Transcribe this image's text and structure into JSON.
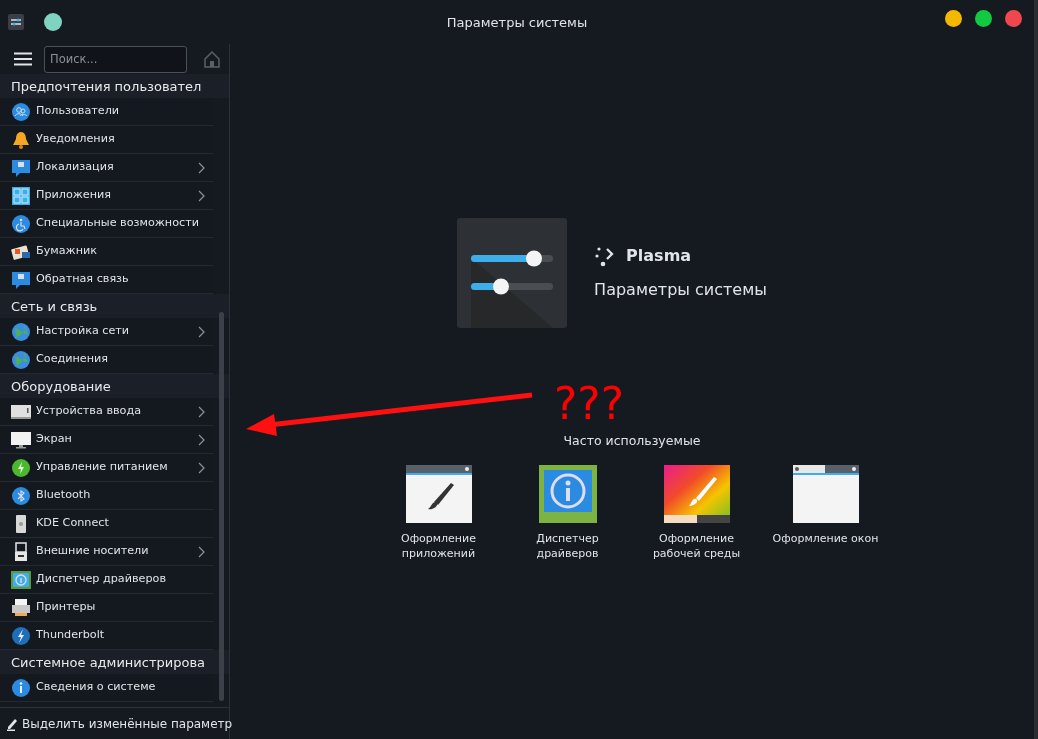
{
  "window": {
    "title": "Параметры системы"
  },
  "sidebar": {
    "search": {
      "placeholder": "Поиск..."
    },
    "sections": [
      {
        "title": "Предпочтения пользовател",
        "items": [
          {
            "label": "Пользователи",
            "expandable": false
          },
          {
            "label": "Уведомления",
            "expandable": false
          },
          {
            "label": "Локализация",
            "expandable": true
          },
          {
            "label": "Приложения",
            "expandable": true
          },
          {
            "label": "Специальные возможности",
            "expandable": false
          },
          {
            "label": "Бумажник",
            "expandable": false
          },
          {
            "label": "Обратная связь",
            "expandable": false
          }
        ]
      },
      {
        "title": "Сеть и связь",
        "items": [
          {
            "label": "Настройка сети",
            "expandable": true
          },
          {
            "label": "Соединения",
            "expandable": false
          }
        ]
      },
      {
        "title": "Оборудование",
        "items": [
          {
            "label": "Устройства ввода",
            "expandable": true
          },
          {
            "label": "Экран",
            "expandable": true
          },
          {
            "label": "Управление питанием",
            "expandable": true
          },
          {
            "label": "Bluetooth",
            "expandable": false
          },
          {
            "label": "KDE Connect",
            "expandable": false
          },
          {
            "label": "Внешние носители",
            "expandable": true
          },
          {
            "label": "Диспетчер драйверов",
            "expandable": false
          },
          {
            "label": "Принтеры",
            "expandable": false
          },
          {
            "label": "Thunderbolt",
            "expandable": false
          }
        ]
      },
      {
        "title": "Системное администрирова",
        "items": [
          {
            "label": "Сведения о системе",
            "expandable": false
          }
        ]
      }
    ],
    "footer": "Выделить изменённые параметр"
  },
  "main": {
    "brand": "Plasma",
    "subtitle": "Параметры системы",
    "annotation": "???",
    "frequent_heading": "Часто используемые",
    "frequent": [
      {
        "label": "Оформление приложений"
      },
      {
        "label": "Диспетчер драйверов"
      },
      {
        "label": "Оформление рабочей среды"
      },
      {
        "label": "Оформление окон"
      }
    ]
  }
}
